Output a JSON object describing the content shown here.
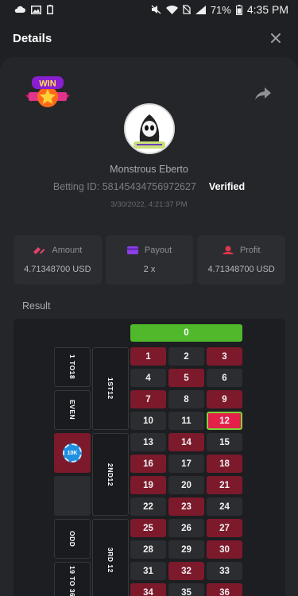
{
  "status_bar": {
    "battery": "71%",
    "time": "4:35 PM"
  },
  "header": {
    "title": "Details"
  },
  "details": {
    "username": "Monstrous Eberto",
    "betting_id": "Betting ID: 58145434756972627",
    "verified": "Verified",
    "date": "3/30/2022, 4:21:37 PM"
  },
  "stats": {
    "amount_label": "Amount",
    "amount_value": "4.71348700 USD",
    "payout_label": "Payout",
    "payout_value": "2 x",
    "profit_label": "Profit",
    "profit_value": "4.71348700 USD"
  },
  "result": {
    "label": "Result",
    "zero": "0",
    "winning_number": 12,
    "red_numbers": [
      1,
      3,
      5,
      7,
      9,
      12,
      14,
      16,
      18,
      19,
      21,
      23,
      25,
      27,
      30,
      32,
      34,
      36
    ],
    "rows": [
      [
        "1",
        "2",
        "3"
      ],
      [
        "4",
        "5",
        "6"
      ],
      [
        "7",
        "8",
        "9"
      ],
      [
        "10",
        "11",
        "12"
      ],
      [
        "13",
        "14",
        "15"
      ],
      [
        "16",
        "17",
        "18"
      ],
      [
        "19",
        "20",
        "21"
      ],
      [
        "22",
        "23",
        "24"
      ],
      [
        "25",
        "26",
        "27"
      ],
      [
        "28",
        "29",
        "30"
      ],
      [
        "31",
        "32",
        "33"
      ],
      [
        "34",
        "35",
        "36"
      ]
    ],
    "dozens": [
      "1ST12",
      "2ND12",
      "3RD 12"
    ],
    "outside": [
      "1 TO18",
      "EVEN",
      "",
      "",
      "ODD",
      "19 TO 36"
    ],
    "chip_label": "10K"
  },
  "colors": {
    "red": "#7c1a2c",
    "hit": "#e3204a",
    "green": "#4fb82b",
    "black": "#2c2d31"
  }
}
